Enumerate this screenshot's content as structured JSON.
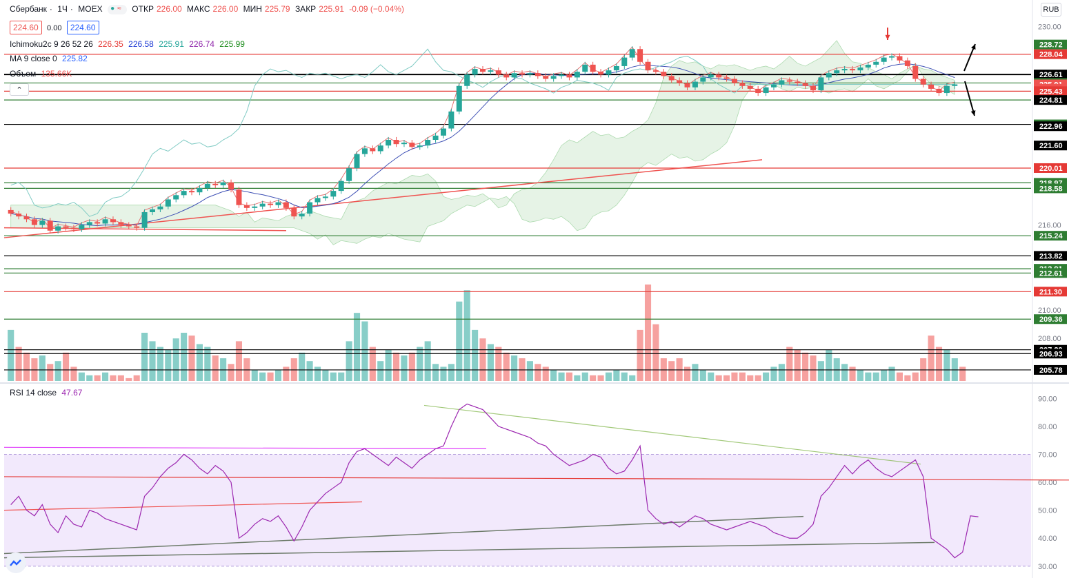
{
  "header": {
    "symbol": "Сбербанк",
    "interval": "1Ч",
    "exchange": "MOEX",
    "open_label": "ОТКР",
    "open": "226.00",
    "high_label": "МАКС",
    "high": "226.00",
    "low_label": "МИН",
    "low": "225.79",
    "close_label": "ЗАКР",
    "close": "225.91",
    "change": "-0.09 (−0.04%)",
    "bid": "224.60",
    "spread": "0.00",
    "ask": "224.60"
  },
  "indicators": {
    "ichimoku_label": "Ichimoku2c 9 26 52 26",
    "ichimoku_values": [
      "226.35",
      "226.58",
      "225.91",
      "226.74",
      "225.99"
    ],
    "ichimoku_colors": [
      "#e53935",
      "#1e3bd4",
      "#26a69a",
      "#8e24aa",
      "#1b8c1b"
    ],
    "ma_label": "MA 9 close 0",
    "ma_value": "225.82",
    "volume_label": "Объем",
    "volume_value": "135.66K",
    "rsi_label": "RSI 14 close",
    "rsi_value": "47.67"
  },
  "currency_button": "RUB",
  "colors": {
    "up": "#26a69a",
    "down": "#ef5350",
    "rsi": "#9c27b0",
    "cloud": "#c8e6c9"
  },
  "chart_data": {
    "type": "candlestick",
    "price_axis": {
      "ylim": [
        205.0,
        230.5
      ],
      "ticks": [
        230.0,
        216.0,
        210.0,
        208.0
      ],
      "labels": [
        {
          "v": 228.72,
          "color": "#2e7d32"
        },
        {
          "v": 228.04,
          "color": "#e53935"
        },
        {
          "v": 226.61,
          "color": "#000000"
        },
        {
          "v": 226.01,
          "color": "#2e7d32"
        },
        {
          "v": 225.91,
          "color": "#ef5350"
        },
        {
          "text": "20:18",
          "v": 225.6,
          "color": "#ef5350"
        },
        {
          "v": 225.43,
          "color": "#e53935"
        },
        {
          "v": 224.81,
          "color": "#000000"
        },
        {
          "v": 223.09,
          "color": "#2e7d32"
        },
        {
          "v": 222.96,
          "color": "#000000"
        },
        {
          "v": 221.6,
          "color": "#000000"
        },
        {
          "v": 220.01,
          "color": "#e53935"
        },
        {
          "v": 218.97,
          "color": "#2e7d32"
        },
        {
          "v": 218.58,
          "color": "#2e7d32"
        },
        {
          "v": 215.24,
          "color": "#2e7d32"
        },
        {
          "v": 213.82,
          "color": "#000000"
        },
        {
          "v": 212.91,
          "color": "#2e7d32"
        },
        {
          "v": 212.61,
          "color": "#2e7d32"
        },
        {
          "v": 211.3,
          "color": "#e53935"
        },
        {
          "v": 209.36,
          "color": "#2e7d32"
        },
        {
          "v": 207.2,
          "color": "#000000"
        },
        {
          "v": 206.93,
          "color": "#000000"
        },
        {
          "v": 205.78,
          "color": "#000000"
        }
      ]
    },
    "hlines": [
      {
        "v": 228.04,
        "color": "#e53935"
      },
      {
        "v": 226.61,
        "color": "#000000",
        "w": 2
      },
      {
        "v": 226.01,
        "color": "#2e7d32"
      },
      {
        "v": 225.43,
        "color": "#e53935"
      },
      {
        "v": 224.81,
        "color": "#2e7d32"
      },
      {
        "v": 223.09,
        "color": "#000000"
      },
      {
        "v": 220.01,
        "color": "#e53935"
      },
      {
        "v": 218.97,
        "color": "#2e7d32"
      },
      {
        "v": 218.58,
        "color": "#2e7d32"
      },
      {
        "v": 215.24,
        "color": "#2e7d32"
      },
      {
        "v": 213.82,
        "color": "#000000"
      },
      {
        "v": 212.91,
        "color": "#2e7d32"
      },
      {
        "v": 212.61,
        "color": "#2e7d32"
      },
      {
        "v": 211.3,
        "color": "#e53935"
      },
      {
        "v": 209.36,
        "color": "#2e7d32"
      },
      {
        "v": 207.2,
        "color": "#000000"
      },
      {
        "v": 206.93,
        "color": "#000000"
      },
      {
        "v": 205.78,
        "color": "#000000"
      }
    ],
    "closes": [
      216.8,
      216.6,
      216.4,
      216.0,
      216.3,
      215.6,
      215.9,
      215.8,
      215.7,
      216.0,
      216.2,
      216.1,
      216.4,
      216.2,
      216.0,
      215.9,
      215.8,
      216.9,
      217.1,
      217.3,
      217.8,
      218.1,
      218.4,
      218.3,
      218.6,
      218.9,
      218.8,
      219.0,
      218.5,
      217.4,
      217.2,
      217.3,
      217.5,
      217.4,
      217.6,
      217.2,
      216.6,
      216.8,
      217.6,
      217.9,
      218.0,
      218.4,
      219.1,
      220.0,
      221.0,
      221.4,
      221.2,
      221.6,
      222.0,
      221.7,
      221.8,
      221.5,
      221.6,
      222.0,
      222.3,
      222.8,
      224.0,
      225.8,
      226.6,
      227.0,
      226.8,
      226.9,
      226.6,
      226.4,
      226.7,
      226.6,
      226.7,
      226.5,
      226.3,
      226.5,
      226.6,
      226.4,
      226.8,
      227.3,
      226.8,
      226.6,
      226.9,
      227.2,
      227.8,
      228.4,
      227.5,
      226.9,
      226.8,
      226.5,
      226.2,
      226.0,
      225.7,
      226.1,
      226.4,
      226.6,
      226.4,
      226.3,
      226.0,
      225.8,
      225.6,
      225.3,
      225.7,
      225.9,
      226.2,
      226.1,
      226.0,
      225.8,
      225.5,
      226.4,
      226.7,
      226.9,
      227.0,
      226.9,
      227.1,
      227.3,
      227.5,
      227.8,
      227.9,
      227.6,
      227.2,
      226.3,
      225.9,
      225.6,
      225.3,
      225.8,
      225.91
    ],
    "opens_offset": 0.25,
    "volumes": [
      18,
      12,
      10,
      8,
      9,
      6,
      7,
      10,
      5,
      3,
      2,
      2,
      3,
      2,
      2,
      1,
      2,
      17,
      14,
      12,
      11,
      15,
      17,
      16,
      13,
      12,
      9,
      8,
      6,
      14,
      8,
      4,
      3,
      3,
      4,
      5,
      8,
      10,
      7,
      5,
      4,
      3,
      3,
      14,
      24,
      21,
      12,
      7,
      11,
      10,
      9,
      10,
      12,
      14,
      6,
      5,
      6,
      28,
      32,
      18,
      15,
      13,
      12,
      10,
      9,
      8,
      7,
      6,
      5,
      4,
      3,
      3,
      2,
      3,
      2,
      2,
      3,
      4,
      3,
      2,
      18,
      34,
      20,
      8,
      7,
      8,
      5,
      6,
      4,
      3,
      2,
      2,
      3,
      3,
      2,
      2,
      3,
      5,
      6,
      12,
      11,
      10,
      9,
      7,
      11,
      8,
      6,
      5,
      4,
      3,
      3,
      4,
      5,
      3,
      2,
      3,
      8,
      16,
      12,
      11,
      8,
      5
    ],
    "rsi": [
      52,
      55,
      50,
      48,
      52,
      45,
      42,
      48,
      45,
      44,
      50,
      49,
      47,
      46,
      45,
      44,
      43,
      55,
      58,
      62,
      65,
      67,
      70,
      68,
      65,
      63,
      66,
      64,
      60,
      40,
      42,
      45,
      47,
      46,
      48,
      44,
      39,
      44,
      50,
      53,
      56,
      58,
      60,
      67,
      71,
      72,
      70,
      68,
      66,
      69,
      67,
      65,
      68,
      70,
      72,
      73,
      80,
      86,
      88,
      87,
      86,
      83,
      80,
      79,
      78,
      77,
      76,
      74,
      73,
      70,
      68,
      66,
      67,
      68,
      70,
      69,
      65,
      63,
      64,
      68,
      73,
      50,
      47,
      45,
      46,
      44,
      46,
      48,
      47,
      45,
      44,
      43,
      44,
      45,
      46,
      45,
      44,
      42,
      41,
      40,
      40,
      42,
      45,
      55,
      58,
      62,
      66,
      63,
      66,
      68,
      65,
      63,
      62,
      64,
      66,
      68,
      62,
      40,
      38,
      36,
      33,
      35,
      48,
      47.67
    ],
    "rsi_axis": {
      "ylim": [
        27,
        95
      ],
      "ticks": [
        90,
        80,
        70,
        60,
        50,
        40,
        30
      ],
      "band": [
        30,
        70
      ]
    }
  }
}
